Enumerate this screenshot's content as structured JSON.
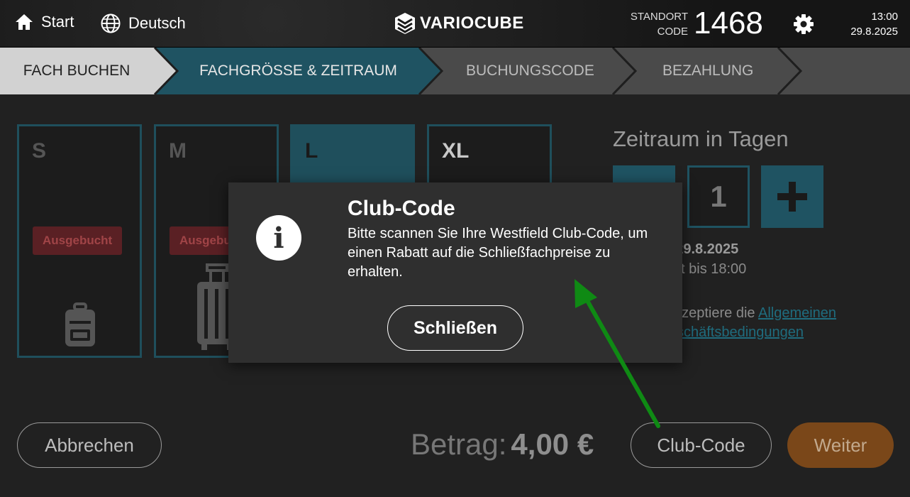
{
  "header": {
    "start_label": "Start",
    "language_label": "Deutsch",
    "brand": "VARIOCUBE",
    "standort_label_1": "STANDORT",
    "standort_label_2": "CODE",
    "standort_code": "1468",
    "time": "13:00",
    "date": "29.8.2025",
    "icons": [
      "home-icon",
      "globe-icon",
      "gear-icon"
    ]
  },
  "steps": [
    {
      "label": "FACH BUCHEN",
      "state": "done"
    },
    {
      "label": "FACHGRÖSSE & ZEITRAUM",
      "state": "active"
    },
    {
      "label": "BUCHUNGSCODE",
      "state": "pending"
    },
    {
      "label": "BEZAHLUNG",
      "state": "pending"
    }
  ],
  "sizes": [
    {
      "label": "S",
      "badge": "Ausgebucht",
      "icon": "backpack-icon"
    },
    {
      "label": "M",
      "badge": "Ausgebucht",
      "icon": "suitcase-icon"
    },
    {
      "label": "L",
      "selected": true
    },
    {
      "label": "XL"
    }
  ],
  "period": {
    "title": "Zeitraum in Tagen",
    "days": "1",
    "date_range_end": "- 29.8.2025",
    "valid_until": "gilt bis 18:00",
    "agb_prefix": "akzeptiere die",
    "agb_link_1": "Allgemeinen",
    "agb_link_2": "schäftsbedingungen"
  },
  "footer": {
    "cancel_label": "Abbrechen",
    "amount_label": "Betrag:",
    "amount_value": "4,00 €",
    "club_code_label": "Club-Code",
    "next_label": "Weiter"
  },
  "modal": {
    "title": "Club-Code",
    "text": "Bitte scannen Sie Ihre Westfield Club-Code, um einen Rabatt auf die Schließfachpreise zu erhalten.",
    "close_label": "Schließen",
    "icon": "info-icon"
  },
  "colors": {
    "accent": "#1f5362",
    "active_step": "#1f5362",
    "next_button": "#7a4719",
    "booked_badge": "#5a2024",
    "annotation_arrow": "#0f8a14"
  }
}
